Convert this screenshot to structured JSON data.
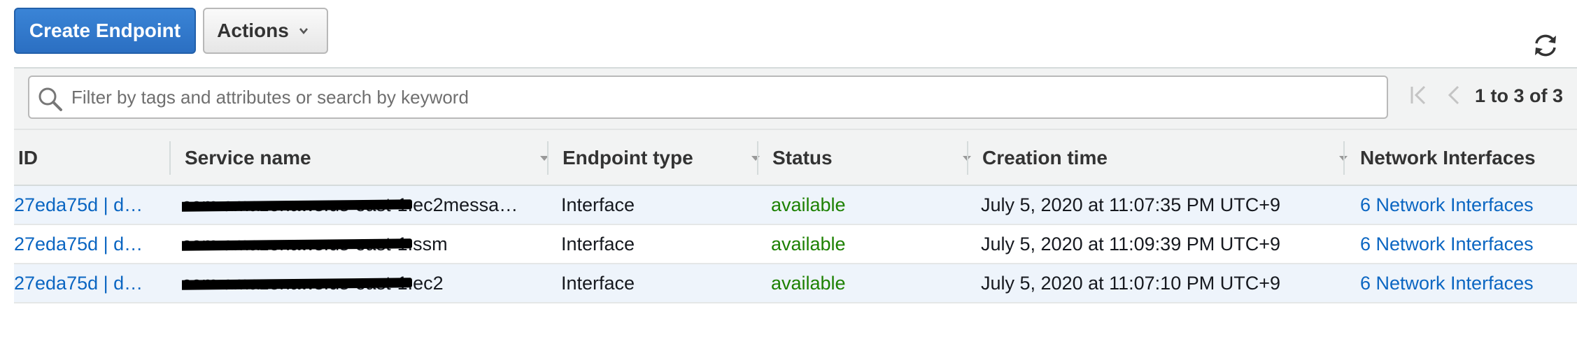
{
  "toolbar": {
    "create_label": "Create Endpoint",
    "actions_label": "Actions"
  },
  "filter": {
    "placeholder": "Filter by tags and attributes or search by keyword",
    "pagination": "1 to 3 of 3"
  },
  "table": {
    "columns": [
      "ID",
      "Service name",
      "Endpoint type",
      "Status",
      "Creation time",
      "Network Interfaces"
    ],
    "rows": [
      {
        "id": "27eda75d | d…",
        "service_prefix": "com.amazonaws.us-east-1",
        "service_suffix": ".ec2messa…",
        "type": "Interface",
        "status": "available",
        "created": "July 5, 2020 at 11:07:35 PM UTC+9",
        "interfaces": "6 Network Interfaces"
      },
      {
        "id": "27eda75d | d…",
        "service_prefix": "com.amazonaws.us-east-1",
        "service_suffix": ".ssm",
        "type": "Interface",
        "status": "available",
        "created": "July 5, 2020 at 11:09:39 PM UTC+9",
        "interfaces": "6 Network Interfaces"
      },
      {
        "id": "27eda75d | d…",
        "service_prefix": "com.amazonaws.us-east-1",
        "service_suffix": ".ec2",
        "type": "Interface",
        "status": "available",
        "created": "July 5, 2020 at 11:07:10 PM UTC+9",
        "interfaces": "6 Network Interfaces"
      }
    ]
  },
  "colors": {
    "primary": "#2b6fc2",
    "link": "#0b66c2",
    "status_available": "#1d8102",
    "row_highlight": "#eef4fb"
  },
  "icons": [
    "refresh-icon",
    "search-icon",
    "first-page-icon",
    "previous-page-icon",
    "chevron-down-icon",
    "sort-caret-icon"
  ]
}
